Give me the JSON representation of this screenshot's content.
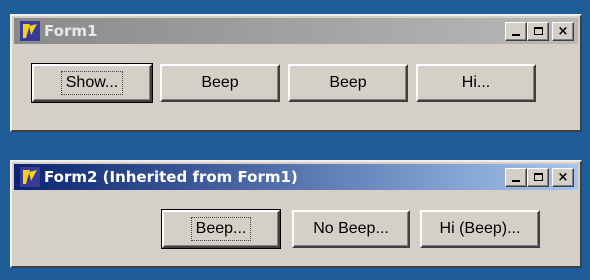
{
  "form1": {
    "title": "Form1",
    "buttons": [
      "Show...",
      "Beep",
      "Beep",
      "Hi..."
    ]
  },
  "form2": {
    "title": "Form2 (Inherited from Form1)",
    "buttons": [
      "Beep...",
      "No Beep...",
      "Hi (Beep)..."
    ]
  },
  "caption_buttons": {
    "close": "×"
  },
  "colors": {
    "desktop": "#1f5d99",
    "inactive_title": "#8a8a8a",
    "active_title": "#0a2470",
    "face": "#d4d0c8"
  },
  "icons": [
    "delphi-app-icon",
    "minimize-icon",
    "maximize-icon",
    "close-icon"
  ]
}
